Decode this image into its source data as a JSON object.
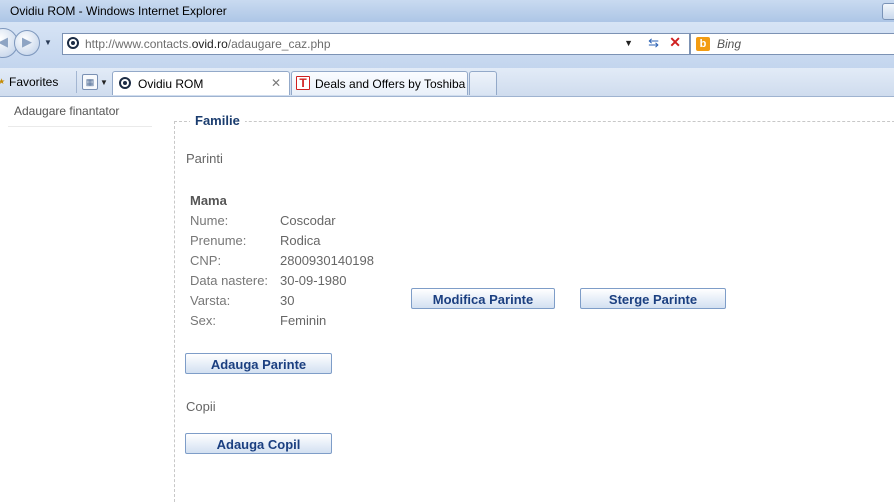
{
  "window": {
    "title": "Ovidiu ROM - Windows Internet Explorer"
  },
  "address_bar": {
    "url_prefix": "http://www.contacts.",
    "url_domain": "ovid.ro",
    "url_path": "/adaugare_caz.php",
    "search_placeholder": "Bing"
  },
  "toolbar": {
    "favorites_label": "Favorites",
    "tabs": [
      {
        "label": "Ovidiu ROM",
        "active": true
      },
      {
        "label": "Deals and Offers by Toshiba",
        "active": false
      }
    ]
  },
  "sidebar": {
    "items": [
      {
        "label": "Adaugare finantator"
      }
    ]
  },
  "main": {
    "section_title": "Familie",
    "parents_heading": "Parinti",
    "parent": {
      "role": "Mama",
      "fields": [
        {
          "label": "Nume:",
          "value": "Coscodar"
        },
        {
          "label": "Prenume:",
          "value": "Rodica"
        },
        {
          "label": "CNP:",
          "value": "2800930140198"
        },
        {
          "label": "Data nastere:",
          "value": "30-09-1980"
        },
        {
          "label": "Varsta:",
          "value": "30"
        },
        {
          "label": "Sex:",
          "value": "Feminin"
        }
      ],
      "modify_button": "Modifica Parinte",
      "delete_button": "Sterge Parinte"
    },
    "add_parent_button": "Adauga Parinte",
    "children_heading": "Copii",
    "add_child_button": "Adauga Copil"
  },
  "colors": {
    "section_title": "#1a3c6e",
    "button_text": "#1b3f80",
    "stop_icon": "#d02020",
    "bing_icon": "#f39c12"
  }
}
